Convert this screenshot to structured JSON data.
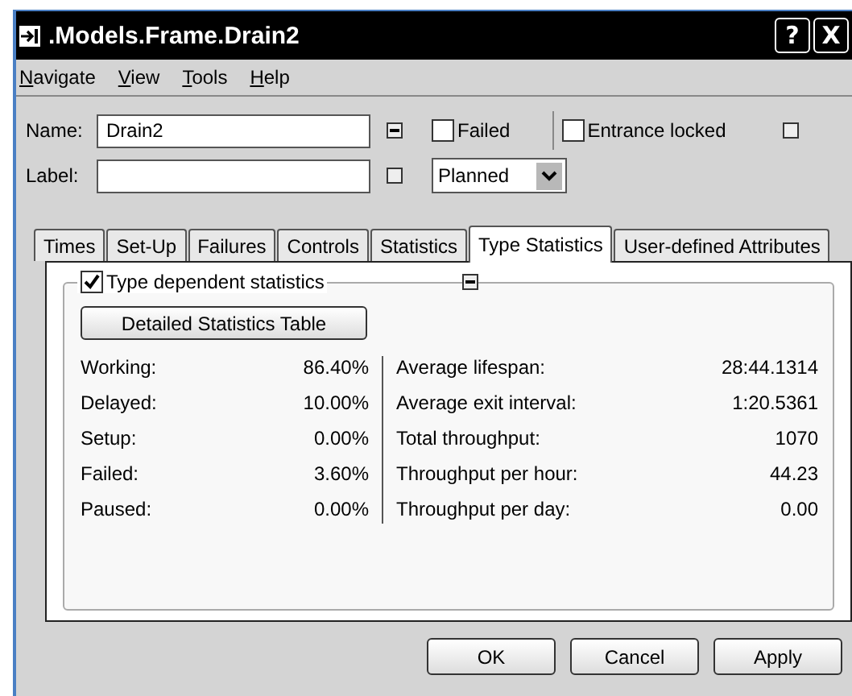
{
  "window": {
    "title": ".Models.Frame.Drain2",
    "help_button": "?",
    "close_button": "X"
  },
  "menu": [
    "Navigate",
    "View",
    "Tools",
    "Help"
  ],
  "form": {
    "name_label": "Name:",
    "name_value": "Drain2",
    "label_label": "Label:",
    "failed": {
      "label": "Failed",
      "checked": false
    },
    "entrance_locked": {
      "label": "Entrance locked",
      "checked": false
    },
    "status": "Planned"
  },
  "tabs": [
    {
      "label": "Times",
      "selected": false
    },
    {
      "label": "Set-Up",
      "selected": false
    },
    {
      "label": "Failures",
      "selected": false
    },
    {
      "label": "Controls",
      "selected": false
    },
    {
      "label": "Statistics",
      "selected": false
    },
    {
      "label": "Type Statistics",
      "selected": true
    },
    {
      "label": "User-defined Attributes",
      "selected": false
    }
  ],
  "type_statistics": {
    "enabled": {
      "label": "Type dependent statistics",
      "checked": true
    },
    "table_button": "Detailed Statistics Table",
    "left": [
      {
        "label": "Working:",
        "value": "86.40%"
      },
      {
        "label": "Delayed:",
        "value": "10.00%"
      },
      {
        "label": "Setup:",
        "value": "0.00%"
      },
      {
        "label": "Failed:",
        "value": "3.60%"
      },
      {
        "label": "Paused:",
        "value": "0.00%"
      }
    ],
    "right": [
      {
        "label": "Average lifespan:",
        "value": "28:44.1314"
      },
      {
        "label": "Average exit interval:",
        "value": "1:20.5361"
      },
      {
        "label": "Total throughput:",
        "value": "1070"
      },
      {
        "label": "Throughput per hour:",
        "value": "44.23"
      },
      {
        "label": "Throughput per day:",
        "value": "0.00"
      }
    ]
  },
  "buttons": [
    "OK",
    "Cancel",
    "Apply"
  ]
}
